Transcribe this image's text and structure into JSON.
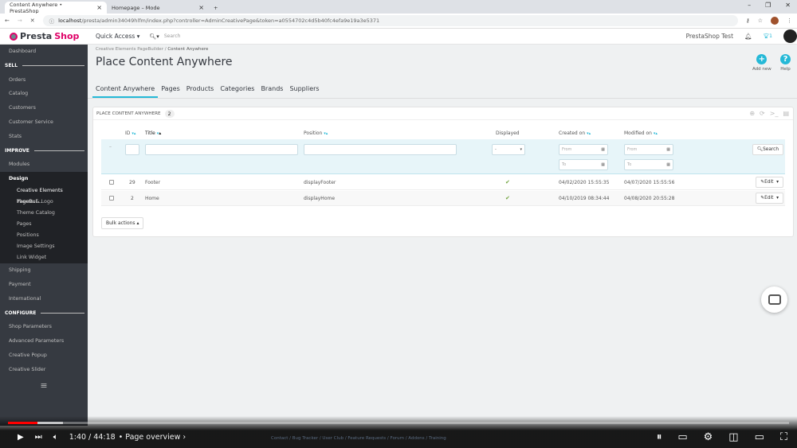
{
  "browser": {
    "tabs": [
      {
        "label": "Content Anywhere • PrestaShop"
      },
      {
        "label": "Homepage – Mode"
      }
    ],
    "url_host": "localhost",
    "url_path": "/presta/admin34049hlfm/index.php?controller=AdminCreativePage&token=a0554702c4d5b40fc4efa9e19a3e5371"
  },
  "header": {
    "logo_a": "Presta",
    "logo_b": "Shop",
    "quick_access": "Quick Access ▾",
    "search_placeholder": "Search",
    "shop_name": "PrestaShop Test",
    "notif_count": "1"
  },
  "sidebar": {
    "dashboard": "Dashboard",
    "sell": "SELL",
    "sell_items": [
      "Orders",
      "Catalog",
      "Customers",
      "Customer Service",
      "Stats"
    ],
    "improve": "IMPROVE",
    "modules": "Modules",
    "design": "Design",
    "design_items": [
      "Creative Elements PageBui...",
      "Theme & Logo",
      "Theme Catalog",
      "Pages",
      "Positions",
      "Image Settings",
      "Link Widget"
    ],
    "improve_rest": [
      "Shipping",
      "Payment",
      "International"
    ],
    "configure": "CONFIGURE",
    "configure_items": [
      "Shop Parameters",
      "Advanced Parameters",
      "Creative Popup",
      "Creative Slider"
    ]
  },
  "page": {
    "breadcrumb": [
      "Creative Elements PageBuilder",
      "Content Anywhere"
    ],
    "title": "Place Content Anywhere",
    "add_new": "Add new",
    "help": "Help",
    "tabs": [
      "Content Anywhere",
      "Pages",
      "Products",
      "Categories",
      "Brands",
      "Suppliers"
    ]
  },
  "panel": {
    "title": "PLACE CONTENT ANYWHERE",
    "count": "2",
    "columns": {
      "id": "ID",
      "title": "Title",
      "position": "Position",
      "displayed": "Displayed",
      "created": "Created on",
      "modified": "Modified on"
    },
    "filters": {
      "displayed": "-",
      "from": "From",
      "to": "To",
      "search": "Search"
    },
    "rows": [
      {
        "id": "29",
        "title": "Footer",
        "position": "displayFooter",
        "created": "04/02/2020 15:55:35",
        "modified": "04/07/2020 15:55:56",
        "edit": "Edit"
      },
      {
        "id": "2",
        "title": "Home",
        "position": "displayHome",
        "created": "04/10/2019 08:34:44",
        "modified": "04/08/2020 20:55:28",
        "edit": "Edit"
      }
    ],
    "bulk": "Bulk actions ▴"
  },
  "video": {
    "time": "1:40 / 44:18",
    "chapter": "• Page overview",
    "progress_percent": 3.8,
    "footer_links": "Contact / Bug Tracker / User Club / Feature Requests / Forum / Addons / Training"
  }
}
